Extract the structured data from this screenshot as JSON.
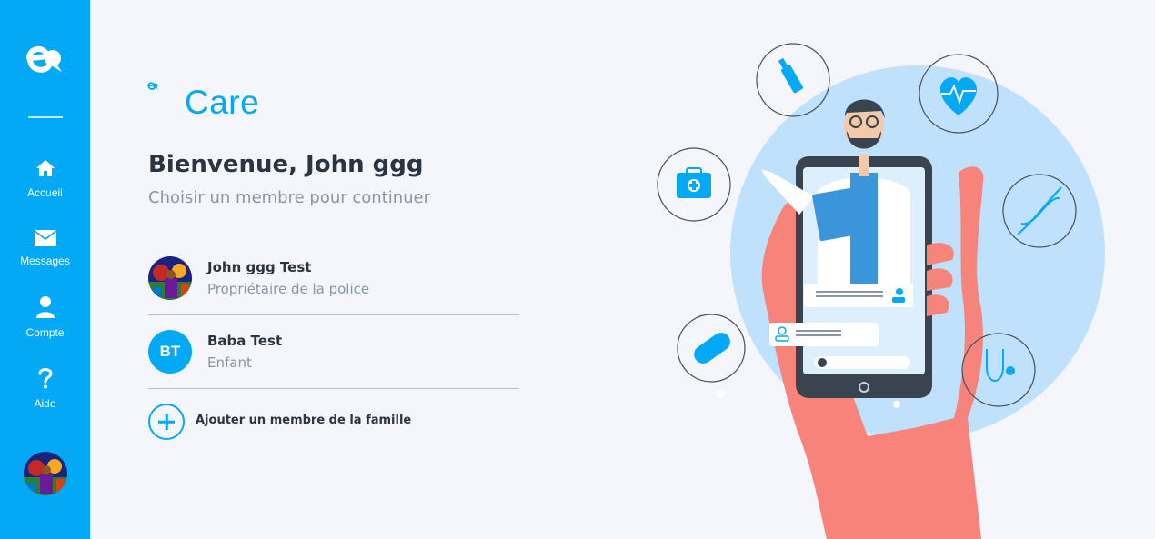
{
  "sidebar": {
    "nav": [
      {
        "label": "Accueil",
        "icon": "home-icon"
      },
      {
        "label": "Messages",
        "icon": "envelope-icon"
      },
      {
        "label": "Compte",
        "icon": "user-icon"
      },
      {
        "label": "Aide",
        "icon": "question-icon"
      }
    ]
  },
  "brand": {
    "name": "Care",
    "color": "#03a9f4"
  },
  "welcome": {
    "title": "Bienvenue, John ggg",
    "subtitle": "Choisir un membre pour continuer"
  },
  "members": [
    {
      "name": "John ggg Test",
      "role": "Propriétaire de la police",
      "avatar": "photo"
    },
    {
      "name": "Baba Test",
      "role": "Enfant",
      "initials": "BT"
    }
  ],
  "add_member": {
    "label": "Ajouter un membre de la famille"
  },
  "colors": {
    "accent": "#03a9f4",
    "background": "#f5f6fb",
    "text": "#2c3440",
    "muted": "#8a95a5",
    "hand": "#f7847a"
  }
}
